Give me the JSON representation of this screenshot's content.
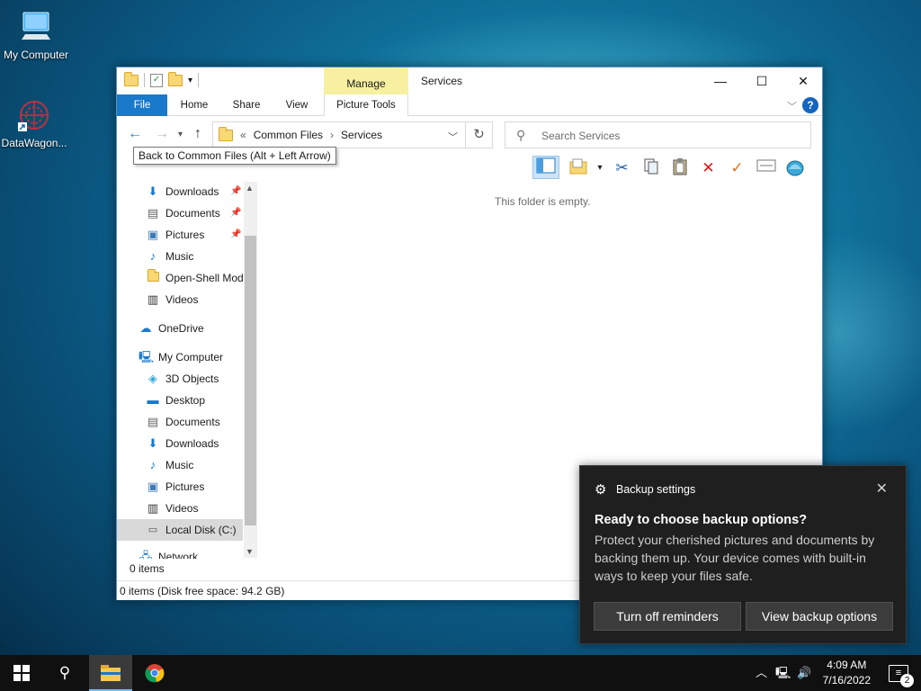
{
  "desktop": {
    "icons": [
      {
        "label": "My Computer"
      },
      {
        "label": "DataWagon..."
      }
    ]
  },
  "window": {
    "title": "Services",
    "context_tab_group": "Manage",
    "ribbon_tabs": [
      "File",
      "Home",
      "Share",
      "View",
      "Picture Tools"
    ],
    "address": {
      "crumbs": [
        "Common Files",
        "Services"
      ],
      "overflow": "«"
    },
    "search_placeholder": "Search Services",
    "tooltip": "Back to Common Files (Alt + Left Arrow)",
    "empty_message": "This folder is empty.",
    "item_count": "0 items",
    "status": "0 items (Disk free space: 94.2 GB)",
    "nav": {
      "quick_access": [
        {
          "label": "Downloads",
          "icon": "download-arrow-icon",
          "pinned": true
        },
        {
          "label": "Documents",
          "icon": "document-icon",
          "pinned": true
        },
        {
          "label": "Pictures",
          "icon": "pictures-icon",
          "pinned": true
        },
        {
          "label": "Music",
          "icon": "music-note-icon",
          "pinned": false
        },
        {
          "label": "Open-Shell Mod",
          "icon": "folder-icon",
          "pinned": false
        },
        {
          "label": "Videos",
          "icon": "film-icon",
          "pinned": false
        }
      ],
      "onedrive": "OneDrive",
      "my_computer": "My Computer",
      "computer_items": [
        {
          "label": "3D Objects",
          "icon": "cube-icon"
        },
        {
          "label": "Desktop",
          "icon": "desktop-icon"
        },
        {
          "label": "Documents",
          "icon": "document-icon"
        },
        {
          "label": "Downloads",
          "icon": "download-arrow-icon"
        },
        {
          "label": "Music",
          "icon": "music-note-icon"
        },
        {
          "label": "Pictures",
          "icon": "pictures-icon"
        },
        {
          "label": "Videos",
          "icon": "film-icon"
        },
        {
          "label": "Local Disk (C:)",
          "icon": "drive-icon"
        }
      ],
      "network": "Network"
    }
  },
  "toast": {
    "app": "Backup settings",
    "heading": "Ready to choose backup options?",
    "body": "Protect your cherished pictures and documents by backing them up. Your device comes with built-in ways to keep your files safe.",
    "btn_off": "Turn off reminders",
    "btn_view": "View backup options"
  },
  "taskbar": {
    "time": "4:09 AM",
    "date": "7/16/2022",
    "notification_count": "2"
  },
  "colors": {
    "accent": "#1979ca",
    "manage_tab": "#f7f0a0",
    "toast_bg": "#1f1f1f",
    "taskbar": "#101010"
  }
}
